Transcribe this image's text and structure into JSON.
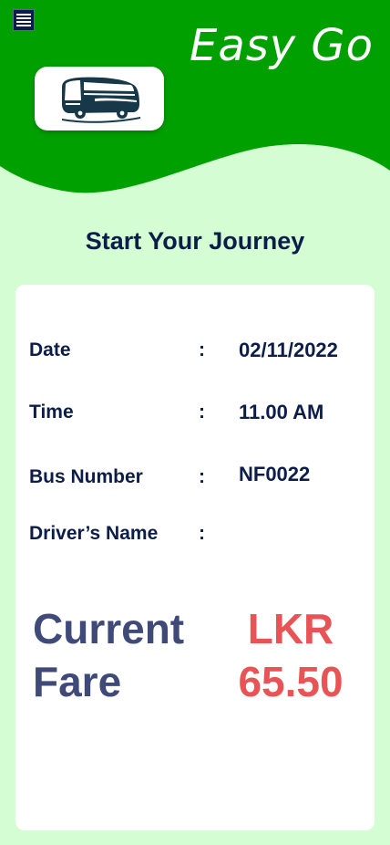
{
  "header": {
    "app_title": "Easy Go",
    "menu_icon": "menu-icon",
    "logo_icon": "bus-icon",
    "brand_green": "#00a000"
  },
  "journey": {
    "heading": "Start Your Journey"
  },
  "trip_info": {
    "colon": ":",
    "rows": [
      {
        "label": "Date",
        "value": "02/11/2022"
      },
      {
        "label": "Time",
        "value": "11.00 AM"
      },
      {
        "label": "Bus Number",
        "value": "NF0022"
      },
      {
        "label": "Driver’s Name",
        "value": ""
      }
    ]
  },
  "fare": {
    "label_line1": "Current",
    "label_line2": "Fare",
    "currency": "LKR",
    "amount": "65.50",
    "fare_color": "#e85456"
  }
}
